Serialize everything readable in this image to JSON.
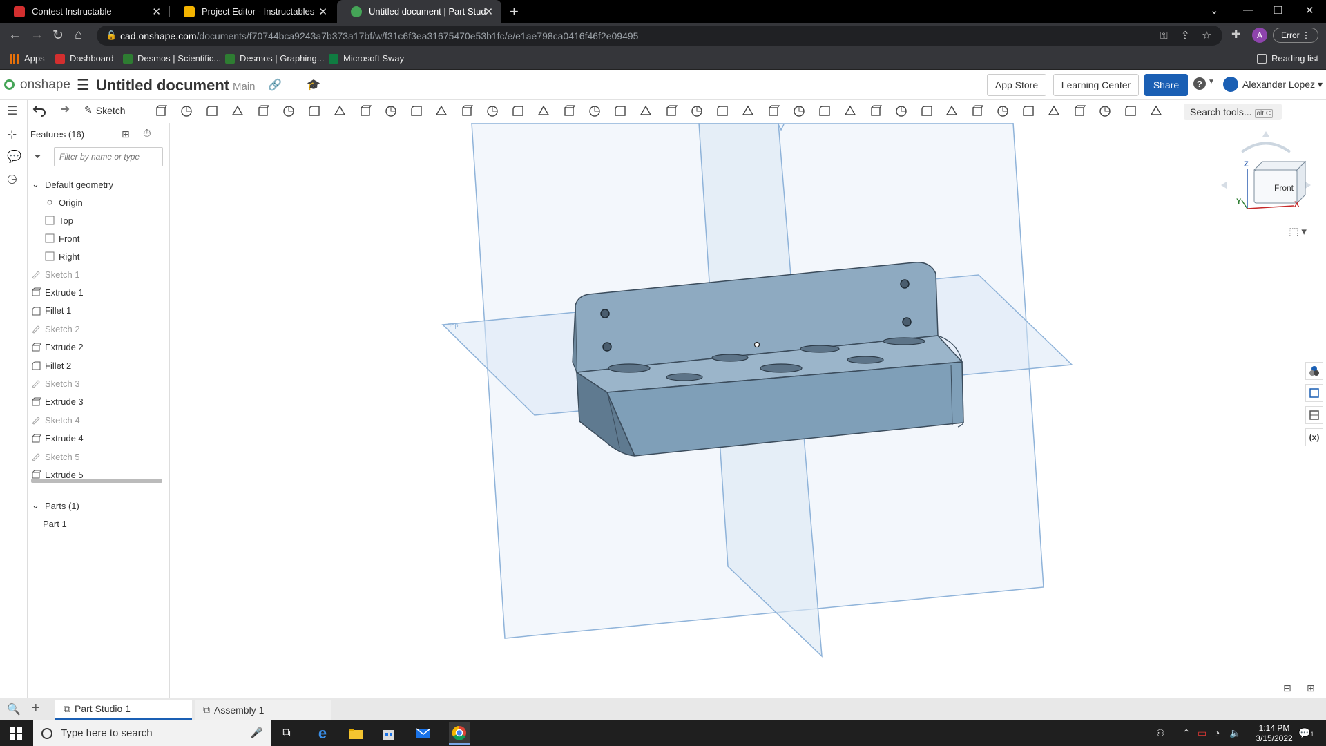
{
  "browser": {
    "tabs": [
      {
        "title": "Contest Instructable",
        "active": false
      },
      {
        "title": "Project Editor - Instructables",
        "active": false
      },
      {
        "title": "Untitled document | Part Studio 1",
        "active": true
      }
    ],
    "url_host": "cad.onshape.com",
    "url_path": "/documents/f70744bca9243a7b373a17bf/w/f31c6f3ea31675470e53b1fc/e/e1ae798ca0416f46f2e09495",
    "profile_initial": "A",
    "error_label": "Error",
    "bookmarks": [
      "Apps",
      "Dashboard",
      "Desmos | Scientific...",
      "Desmos | Graphing...",
      "Microsoft Sway"
    ],
    "reading_list": "Reading list"
  },
  "onshape": {
    "logo": "onshape",
    "doc_title": "Untitled document",
    "branch": "Main",
    "app_store": "App Store",
    "learning_center": "Learning Center",
    "share": "Share",
    "help": "?",
    "user_name": "Alexander Lopez",
    "sketch_label": "Sketch",
    "search_tools": "Search tools...",
    "search_shortcut": "alt C"
  },
  "features": {
    "title": "Features (16)",
    "filter_placeholder": "Filter by name or type",
    "default_geometry": "Default geometry",
    "geometry_items": [
      "Origin",
      "Top",
      "Front",
      "Right"
    ],
    "items": [
      {
        "label": "Sketch 1",
        "kind": "sketch"
      },
      {
        "label": "Extrude 1",
        "kind": "extrude"
      },
      {
        "label": "Fillet 1",
        "kind": "fillet"
      },
      {
        "label": "Sketch 2",
        "kind": "sketch"
      },
      {
        "label": "Extrude 2",
        "kind": "extrude"
      },
      {
        "label": "Fillet 2",
        "kind": "fillet"
      },
      {
        "label": "Sketch 3",
        "kind": "sketch"
      },
      {
        "label": "Extrude 3",
        "kind": "extrude"
      },
      {
        "label": "Sketch 4",
        "kind": "sketch"
      },
      {
        "label": "Extrude 4",
        "kind": "extrude"
      },
      {
        "label": "Sketch 5",
        "kind": "sketch"
      },
      {
        "label": "Extrude 5",
        "kind": "extrude"
      }
    ],
    "parts_title": "Parts (1)",
    "parts": [
      "Part 1"
    ]
  },
  "viewcube": {
    "face": "Front",
    "axis_z": "Z",
    "axis_x": "X",
    "axis_y": "Y"
  },
  "bottom_tabs": [
    {
      "label": "Part Studio 1",
      "active": true
    },
    {
      "label": "Assembly 1",
      "active": false
    }
  ],
  "taskbar": {
    "search_placeholder": "Type here to search",
    "time": "1:14 PM",
    "date": "3/15/2022",
    "notification_count": "1"
  },
  "colors": {
    "part_face": "#7f9fb8",
    "plane_fill": "#dbe8f5",
    "plane_stroke": "#8fb3d9",
    "accent": "#1a5fb4",
    "logo_green": "#45a557"
  }
}
